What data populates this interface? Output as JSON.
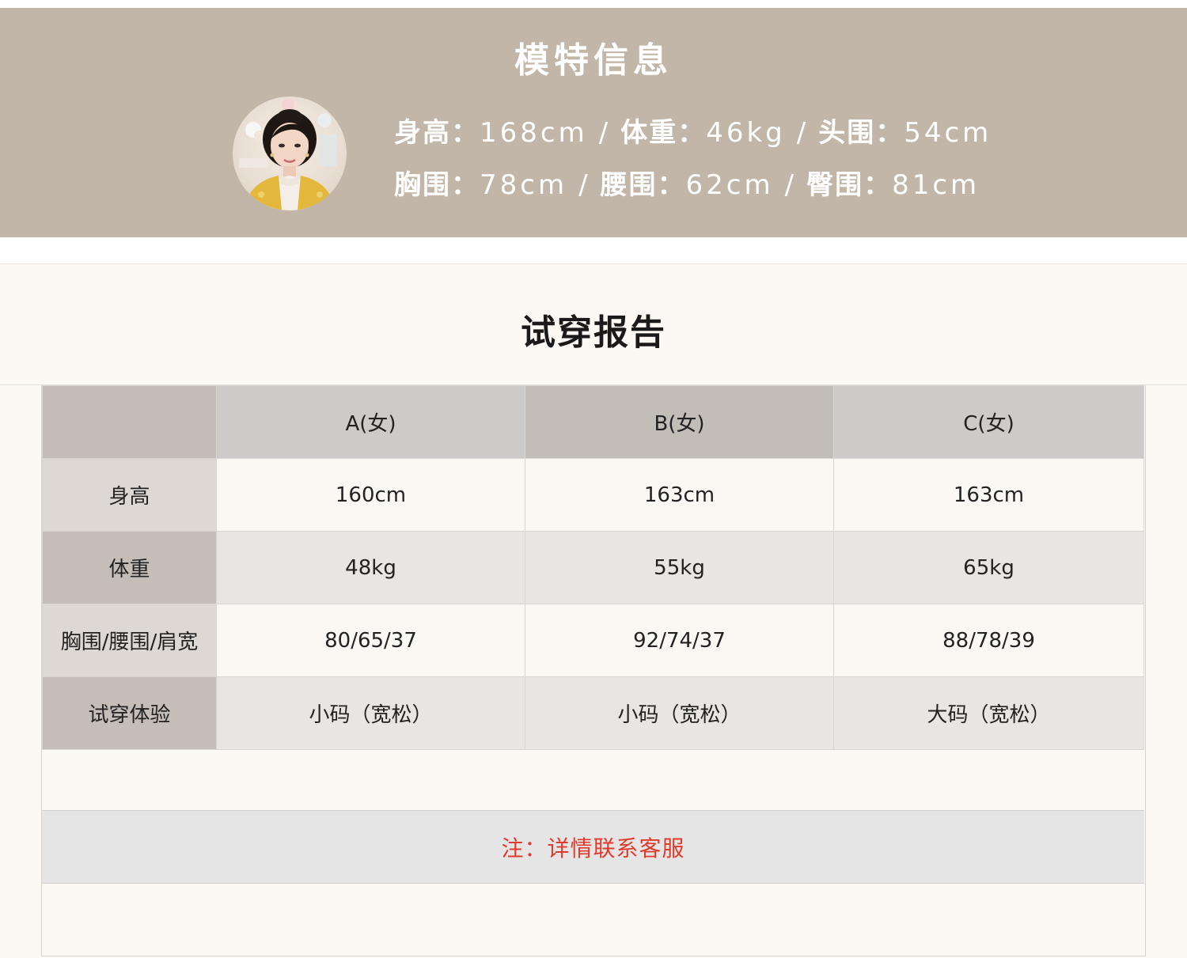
{
  "model_info": {
    "title": "模特信息",
    "avatar": "model-portrait",
    "line1": [
      {
        "label": "身高：",
        "value": "168cm"
      },
      {
        "label": "体重：",
        "value": "46kg"
      },
      {
        "label": "头围：",
        "value": "54cm"
      }
    ],
    "line2": [
      {
        "label": "胸围：",
        "value": "78cm"
      },
      {
        "label": "腰围：",
        "value": "62cm"
      },
      {
        "label": "臀围：",
        "value": "81cm"
      }
    ],
    "separator": "/"
  },
  "report": {
    "title": "试穿报告",
    "columns": [
      "",
      "A(女)",
      "B(女)",
      "C(女)"
    ],
    "rows": [
      {
        "label": "身高",
        "values": [
          "160cm",
          "163cm",
          "163cm"
        ]
      },
      {
        "label": "体重",
        "values": [
          "48kg",
          "55kg",
          "65kg"
        ]
      },
      {
        "label": "胸围/腰围/肩宽",
        "values": [
          "80/65/37",
          "92/74/37",
          "88/78/39"
        ]
      },
      {
        "label": "试穿体验",
        "values": [
          "小码（宽松）",
          "小码（宽松）",
          "大码（宽松）"
        ]
      }
    ],
    "note": "注：详情联系客服",
    "note_color": "#e03a2a"
  },
  "colors": {
    "banner": "#c2b6a8",
    "page": "#fcf9f5"
  }
}
